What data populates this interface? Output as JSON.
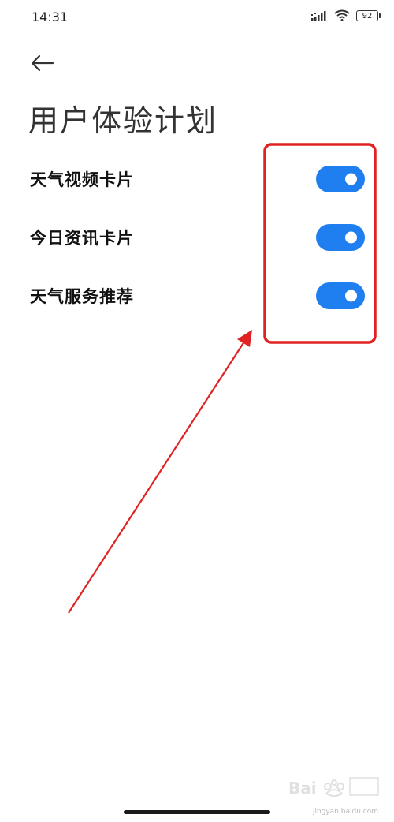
{
  "status_bar": {
    "time": "14:31",
    "battery_level": "92",
    "icons": [
      "signal-icon",
      "wifi-icon",
      "battery-icon"
    ]
  },
  "header": {
    "back_icon": "arrow-left-icon",
    "title": "用户体验计划"
  },
  "settings": {
    "items": [
      {
        "label": "天气视频卡片",
        "enabled": true
      },
      {
        "label": "今日资讯卡片",
        "enabled": true
      },
      {
        "label": "天气服务推荐",
        "enabled": true
      }
    ]
  },
  "annotation": {
    "color": "#e02222",
    "shapes": [
      "highlight-box",
      "pointer-arrow"
    ]
  },
  "watermark": {
    "brand": "Bai 经验",
    "url": "jingyan.baidu.com"
  },
  "colors": {
    "toggle_on": "#1f7ff1",
    "annotation_red": "#e02222"
  }
}
